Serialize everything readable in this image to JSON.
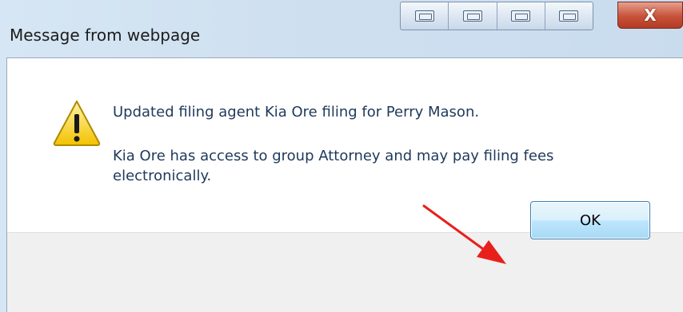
{
  "window": {
    "title": "Message from webpage",
    "close_label": "X",
    "titlebar_buttons": [
      "view-icon-1",
      "view-icon-2",
      "view-icon-3",
      "view-icon-4"
    ]
  },
  "dialog": {
    "icon": "warning-icon",
    "message_line_1": "Updated filing agent Kia Ore filing for Perry Mason.",
    "message_line_2": "Kia Ore has access to group Attorney and may pay filing fees electronically.",
    "ok_label": "OK"
  },
  "annotation": {
    "icon": "red-arrow-icon",
    "color": "#e8201c"
  },
  "colors": {
    "message_text": "#1e395b",
    "ok_border": "#3c7fb1",
    "close_red": "#c7523a"
  }
}
